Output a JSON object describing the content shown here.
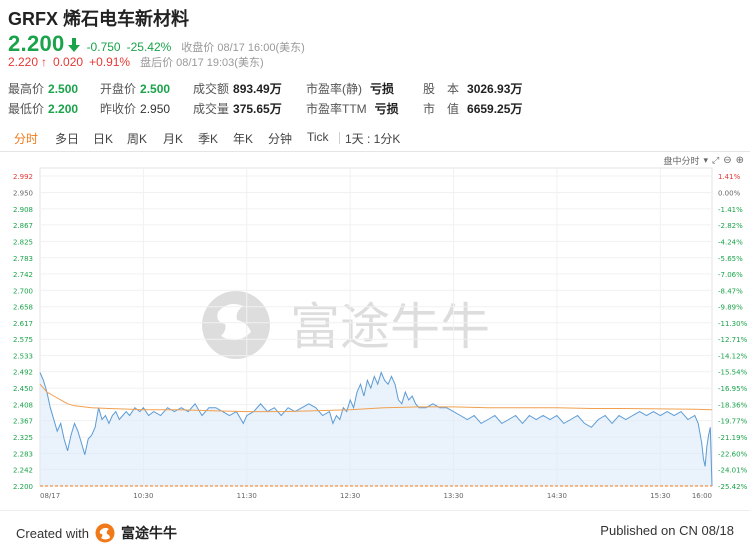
{
  "header": {
    "title": "GRFX 烯石电车新材料"
  },
  "quote": {
    "price": "2.200",
    "change": "-0.750",
    "change_pct": "-25.42%",
    "close_label": "收盘价 08/17 16:00(美东)",
    "after_price": "2.220",
    "after_change": "0.020",
    "after_pct": "+0.91%",
    "after_label": "盘后价 08/17 19:03(美东)"
  },
  "stats": {
    "high_label": "最高价",
    "high": "2.500",
    "open_label": "开盘价",
    "open": "2.500",
    "turnover_label": "成交额",
    "turnover": "893.49万",
    "pe_static_label": "市盈率(静)",
    "pe_static": "亏损",
    "shares_label": "股　本",
    "shares": "3026.93万",
    "low_label": "最低价",
    "low": "2.200",
    "prev_label": "昨收价",
    "prev": "2.950",
    "volume_label": "成交量",
    "volume": "375.65万",
    "pe_ttm_label": "市盈率TTM",
    "pe_ttm": "亏损",
    "mktcap_label": "市　值",
    "mktcap": "6659.25万"
  },
  "tabs": {
    "items": [
      "分时",
      "多日",
      "日K",
      "周K",
      "月K",
      "季K",
      "年K",
      "分钟",
      "Tick"
    ],
    "period": "1天 : 1分K",
    "active_index": 0
  },
  "chart_mode": "盘中分时",
  "watermark": "富途牛牛",
  "footer": {
    "created_label": "Created with",
    "brand": "富途牛牛",
    "published": "Published on CN 08/18"
  },
  "colors": {
    "down": "#1aa34a",
    "up": "#e53935",
    "accent": "#f07a1a",
    "price_line": "#5b9bd5",
    "avg_line": "#f0a050"
  },
  "chart_data": {
    "type": "line",
    "title": "",
    "xlabel": "",
    "ylabel": "",
    "ylim": [
      2.2,
      2.992
    ],
    "prev_close": 2.95,
    "x_ticks": [
      "08/17",
      "10:30",
      "11:30",
      "12:30",
      "13:30",
      "14:30",
      "15:30",
      "16:00"
    ],
    "y_ticks_left": [
      "2.992",
      "2.950",
      "2.908",
      "2.867",
      "2.825",
      "2.783",
      "2.742",
      "2.700",
      "2.658",
      "2.617",
      "2.575",
      "2.533",
      "2.492",
      "2.450",
      "2.408",
      "2.367",
      "2.325",
      "2.283",
      "2.242",
      "2.200"
    ],
    "y_ticks_right": [
      "1.41%",
      "0.00%",
      "-1.41%",
      "-2.82%",
      "-4.24%",
      "-5.65%",
      "-7.06%",
      "-8.47%",
      "-9.89%",
      "-11.30%",
      "-12.71%",
      "-14.12%",
      "-15.54%",
      "-16.95%",
      "-18.36%",
      "-19.77%",
      "-21.19%",
      "-22.60%",
      "-24.01%",
      "-25.42%"
    ],
    "series": [
      {
        "values": [
          [
            0,
            2.49
          ],
          [
            2,
            2.47
          ],
          [
            4,
            2.44
          ],
          [
            6,
            2.4
          ],
          [
            8,
            2.37
          ],
          [
            10,
            2.34
          ],
          [
            12,
            2.36
          ],
          [
            14,
            2.32
          ],
          [
            16,
            2.29
          ],
          [
            18,
            2.33
          ],
          [
            20,
            2.36
          ],
          [
            22,
            2.34
          ],
          [
            24,
            2.31
          ],
          [
            26,
            2.28
          ],
          [
            28,
            2.32
          ],
          [
            30,
            2.33
          ],
          [
            32,
            2.35
          ],
          [
            34,
            2.4
          ],
          [
            36,
            2.37
          ],
          [
            38,
            2.38
          ],
          [
            40,
            2.36
          ],
          [
            42,
            2.38
          ],
          [
            44,
            2.39
          ],
          [
            46,
            2.37
          ],
          [
            48,
            2.38
          ],
          [
            50,
            2.39
          ],
          [
            52,
            2.38
          ],
          [
            55,
            2.4
          ],
          [
            58,
            2.39
          ],
          [
            60,
            2.4
          ],
          [
            63,
            2.38
          ],
          [
            66,
            2.39
          ],
          [
            70,
            2.38
          ],
          [
            74,
            2.4
          ],
          [
            78,
            2.39
          ],
          [
            82,
            2.4
          ],
          [
            86,
            2.39
          ],
          [
            90,
            2.41
          ],
          [
            94,
            2.38
          ],
          [
            98,
            2.4
          ],
          [
            102,
            2.4
          ],
          [
            106,
            2.39
          ],
          [
            110,
            2.38
          ],
          [
            114,
            2.39
          ],
          [
            118,
            2.36
          ],
          [
            120,
            2.38
          ],
          [
            124,
            2.39
          ],
          [
            128,
            2.41
          ],
          [
            132,
            2.39
          ],
          [
            136,
            2.4
          ],
          [
            140,
            2.38
          ],
          [
            144,
            2.4
          ],
          [
            148,
            2.39
          ],
          [
            152,
            2.4
          ],
          [
            156,
            2.41
          ],
          [
            160,
            2.4
          ],
          [
            164,
            2.38
          ],
          [
            168,
            2.39
          ],
          [
            170,
            2.36
          ],
          [
            172,
            2.38
          ],
          [
            174,
            2.37
          ],
          [
            176,
            2.4
          ],
          [
            178,
            2.39
          ],
          [
            180,
            2.42
          ],
          [
            182,
            2.4
          ],
          [
            184,
            2.44
          ],
          [
            186,
            2.46
          ],
          [
            188,
            2.43
          ],
          [
            190,
            2.47
          ],
          [
            192,
            2.45
          ],
          [
            194,
            2.48
          ],
          [
            196,
            2.46
          ],
          [
            198,
            2.49
          ],
          [
            200,
            2.47
          ],
          [
            202,
            2.46
          ],
          [
            204,
            2.48
          ],
          [
            206,
            2.46
          ],
          [
            208,
            2.42
          ],
          [
            210,
            2.41
          ],
          [
            212,
            2.44
          ],
          [
            214,
            2.42
          ],
          [
            216,
            2.43
          ],
          [
            218,
            2.41
          ],
          [
            220,
            2.4
          ],
          [
            224,
            2.4
          ],
          [
            228,
            2.41
          ],
          [
            232,
            2.4
          ],
          [
            236,
            2.4
          ],
          [
            240,
            2.39
          ],
          [
            244,
            2.38
          ],
          [
            248,
            2.37
          ],
          [
            252,
            2.38
          ],
          [
            256,
            2.36
          ],
          [
            260,
            2.37
          ],
          [
            264,
            2.38
          ],
          [
            268,
            2.36
          ],
          [
            272,
            2.37
          ],
          [
            276,
            2.38
          ],
          [
            280,
            2.36
          ],
          [
            284,
            2.38
          ],
          [
            288,
            2.37
          ],
          [
            292,
            2.38
          ],
          [
            296,
            2.37
          ],
          [
            300,
            2.38
          ],
          [
            304,
            2.36
          ],
          [
            308,
            2.37
          ],
          [
            312,
            2.38
          ],
          [
            316,
            2.36
          ],
          [
            320,
            2.35
          ],
          [
            324,
            2.37
          ],
          [
            328,
            2.38
          ],
          [
            332,
            2.36
          ],
          [
            336,
            2.38
          ],
          [
            340,
            2.37
          ],
          [
            344,
            2.38
          ],
          [
            348,
            2.39
          ],
          [
            352,
            2.38
          ],
          [
            356,
            2.39
          ],
          [
            360,
            2.38
          ],
          [
            364,
            2.39
          ],
          [
            368,
            2.38
          ],
          [
            372,
            2.39
          ],
          [
            376,
            2.37
          ],
          [
            380,
            2.38
          ],
          [
            382,
            2.36
          ],
          [
            384,
            2.31
          ],
          [
            385,
            2.27
          ],
          [
            386,
            2.25
          ],
          [
            387,
            2.3
          ],
          [
            388,
            2.33
          ],
          [
            389,
            2.35
          ],
          [
            390,
            2.2
          ]
        ]
      },
      {
        "values": [
          [
            0,
            2.46
          ],
          [
            4,
            2.44
          ],
          [
            8,
            2.43
          ],
          [
            12,
            2.42
          ],
          [
            16,
            2.41
          ],
          [
            20,
            2.405
          ],
          [
            30,
            2.4
          ],
          [
            40,
            2.398
          ],
          [
            60,
            2.395
          ],
          [
            80,
            2.395
          ],
          [
            100,
            2.392
          ],
          [
            120,
            2.39
          ],
          [
            140,
            2.39
          ],
          [
            160,
            2.392
          ],
          [
            180,
            2.395
          ],
          [
            200,
            2.4
          ],
          [
            220,
            2.402
          ],
          [
            240,
            2.402
          ],
          [
            260,
            2.4
          ],
          [
            280,
            2.4
          ],
          [
            300,
            2.4
          ],
          [
            320,
            2.398
          ],
          [
            340,
            2.398
          ],
          [
            360,
            2.397
          ],
          [
            380,
            2.396
          ],
          [
            390,
            2.395
          ]
        ]
      }
    ]
  }
}
